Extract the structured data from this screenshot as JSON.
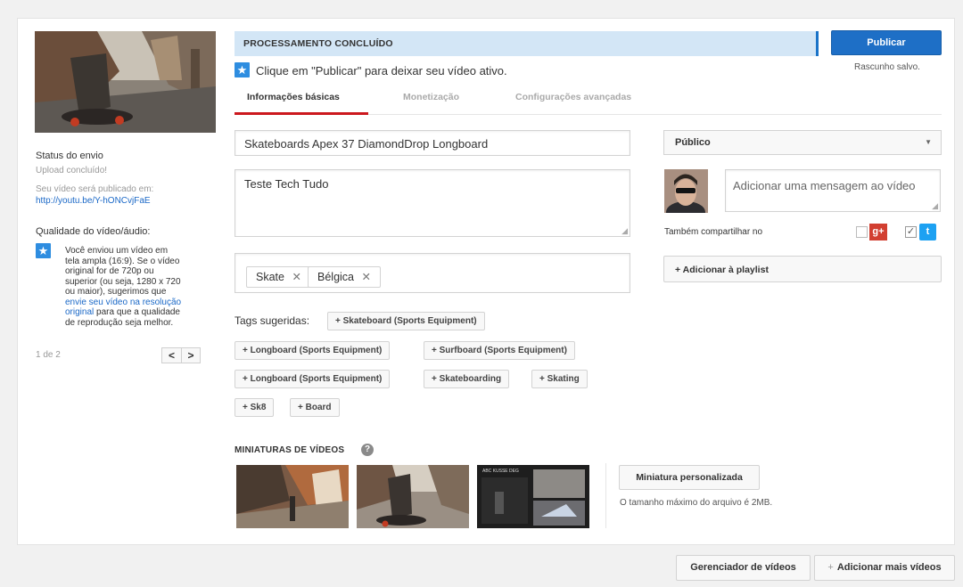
{
  "status_bar": {
    "text": "PROCESSAMENTO CONCLUÍDO"
  },
  "publish": {
    "label": "Publicar",
    "draft_status": "Rascunho salvo."
  },
  "notice": {
    "text": "Clique em \"Publicar\" para deixar seu vídeo ativo."
  },
  "tabs": [
    {
      "label": "Informações básicas",
      "active": true
    },
    {
      "label": "Monetização",
      "active": false
    },
    {
      "label": "Configurações avançadas",
      "active": false
    }
  ],
  "left": {
    "upload_status_title": "Status do envio",
    "upload_status_value": "Upload concluído!",
    "publish_note": "Seu vídeo será publicado em:",
    "publish_url": "http://youtu.be/Y-hONCvjFaE",
    "quality_title": "Qualidade do vídeo/áudio:",
    "quality_lines": [
      "Você enviou um vídeo em",
      "tela ampla (16:9). Se o vídeo",
      "original for de 720p ou",
      "superior (ou seja, 1280 x 720",
      "ou maior), sugerimos que"
    ],
    "quality_link_1": "envie seu vídeo na resolução",
    "quality_link_2": "original",
    "quality_after_link": " para que a qualidade",
    "quality_last": "de reprodução seja melhor.",
    "pager": "1 de 2",
    "prev": "<",
    "next": ">"
  },
  "form": {
    "title_value": "Skateboards Apex 37 DiamondDrop Longboard",
    "description_value": "Teste Tech Tudo",
    "tags": [
      "Skate",
      "Bélgica"
    ],
    "suggested_label": "Tags sugeridas:",
    "suggested_tags": [
      "+ Skateboard (Sports Equipment)",
      "+ Longboard (Sports Equipment)",
      "+ Surfboard (Sports Equipment)",
      "+ Longboard (Sports Equipment)",
      "+ Skateboarding",
      "+ Skating",
      "+ Sk8",
      "+ Board"
    ]
  },
  "thumbnails": {
    "title": "MINIATURAS DE VÍDEOS",
    "custom_button": "Miniatura personalizada",
    "max_size_note": "O tamanho máximo do arquivo é 2MB.",
    "third_thumb_caption": "ABC KUSSE DEG"
  },
  "right": {
    "privacy": "Público",
    "message_placeholder": "Adicionar uma mensagem ao vídeo",
    "share_label": "Também compartilhar no",
    "playlist_button": "+ Adicionar à playlist"
  },
  "footer": {
    "video_manager": "Gerenciador de vídeos",
    "add_more": "Adicionar mais vídeos",
    "add_more_prefix": "+"
  },
  "colors": {
    "accent_blue": "#1e6fc6",
    "status_bg": "#d3e6f6",
    "active_tab": "#cc181e",
    "link": "#1a68c7",
    "gplus": "#d23f31",
    "twitter": "#1da1f2"
  }
}
